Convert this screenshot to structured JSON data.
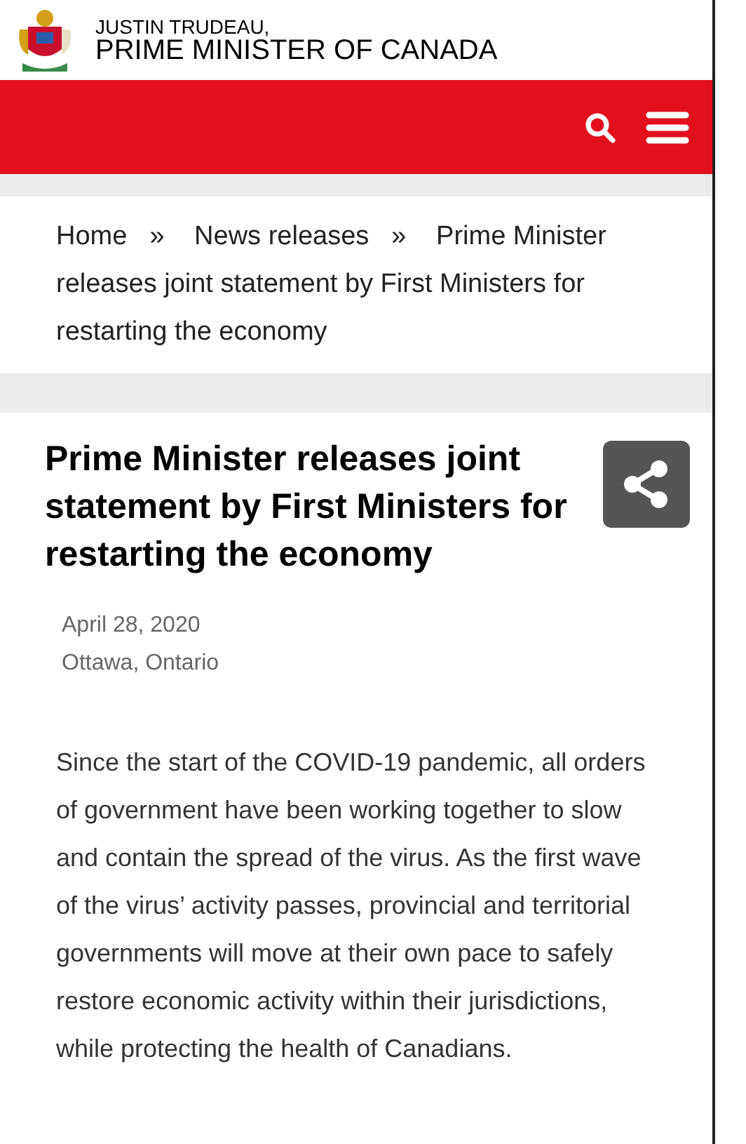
{
  "header": {
    "name": "JUSTIN TRUDEAU,",
    "title": "PRIME MINISTER OF CANADA"
  },
  "breadcrumb": [
    {
      "label": "Home",
      "separator": "»"
    },
    {
      "label": "News releases",
      "separator": "»"
    },
    {
      "label": "Prime Minister releases joint statement by First Ministers for restarting the economy"
    }
  ],
  "article": {
    "title": "Prime Minister releases joint statement by First Ministers for restarting the economy",
    "date": "April 28, 2020",
    "location": "Ottawa, Ontario",
    "body": "Since the start of the COVID-19 pandemic, all orders of government have been working together to slow and contain the spread of the virus. As the first wave of the virus’ activity passes, provincial and territorial governments will move at their own pace to safely restore economic activity within their jurisdictions, while protecting the health of Canadians."
  }
}
